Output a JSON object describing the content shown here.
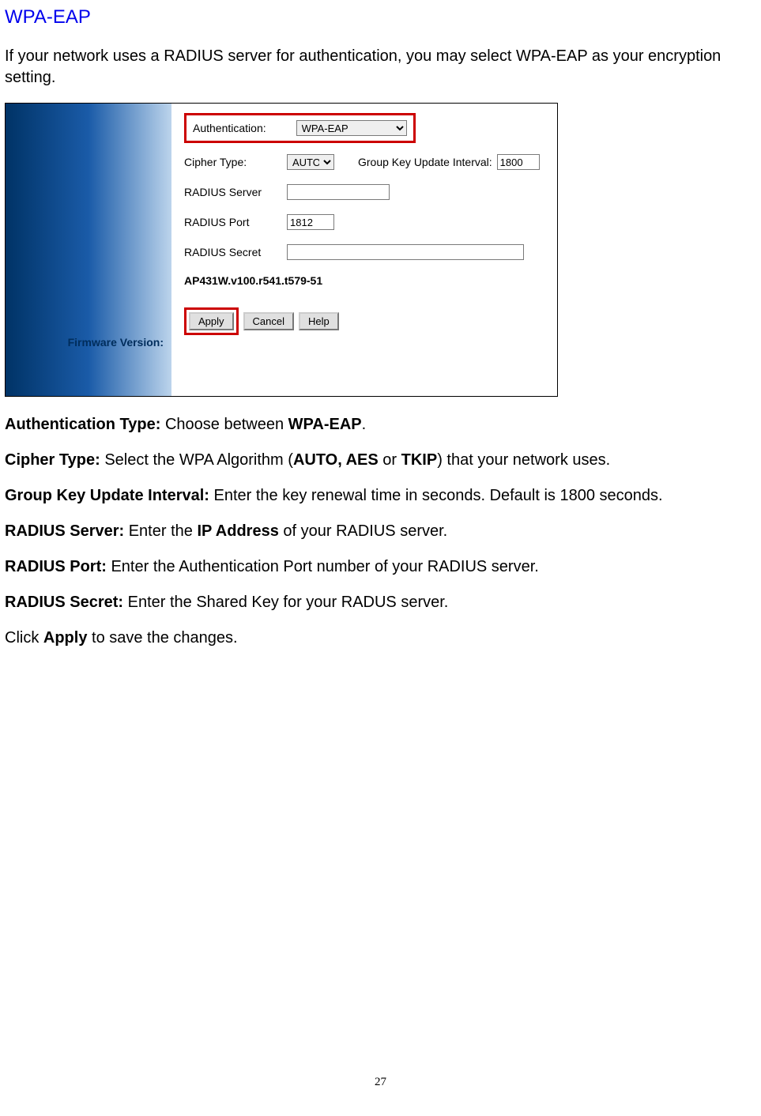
{
  "heading": "WPA-EAP",
  "intro": "If your network uses a RADIUS server for authentication, you may select WPA-EAP as your encryption setting.",
  "form": {
    "auth_label": "Authentication:",
    "auth_value": "WPA-EAP",
    "cipher_label": "Cipher Type:",
    "cipher_value": "AUTO",
    "gku_label": "Group Key Update Interval:",
    "gku_value": "1800",
    "radius_server_label": "RADIUS Server",
    "radius_server_value": "",
    "radius_port_label": "RADIUS Port",
    "radius_port_value": "1812",
    "radius_secret_label": "RADIUS Secret",
    "radius_secret_value": "",
    "fw_label": "Firmware Version:",
    "fw_value": "AP431W.v100.r541.t579-51",
    "apply": "Apply",
    "cancel": "Cancel",
    "help": "Help"
  },
  "desc": {
    "auth_b": "Authentication Type: ",
    "auth_t1": "Choose between ",
    "auth_b2": "WPA-EAP",
    "auth_t2": ".",
    "cipher_b": "Cipher Type: ",
    "cipher_t1": "Select the WPA Algorithm (",
    "cipher_b2": "AUTO, AES",
    "cipher_t2": " or ",
    "cipher_b3": "TKIP",
    "cipher_t3": ") that your network uses.",
    "gku_b": "Group Key Update Interval: ",
    "gku_t": "Enter the key renewal time in seconds.  Default is 1800 seconds.",
    "rs_b": "RADIUS Server: ",
    "rs_t1": "Enter the ",
    "rs_b2": "IP Address",
    "rs_t2": " of your RADIUS server.",
    "rp_b": "RADIUS Port: ",
    "rp_t": "Enter the Authentication Port number of your RADIUS server.",
    "rsec_b": "RADIUS Secret: ",
    "rsec_t": "Enter the Shared Key for your RADUS server.",
    "click_t1": "Click ",
    "click_b": "Apply",
    "click_t2": " to save the changes."
  },
  "pagenum": "27"
}
